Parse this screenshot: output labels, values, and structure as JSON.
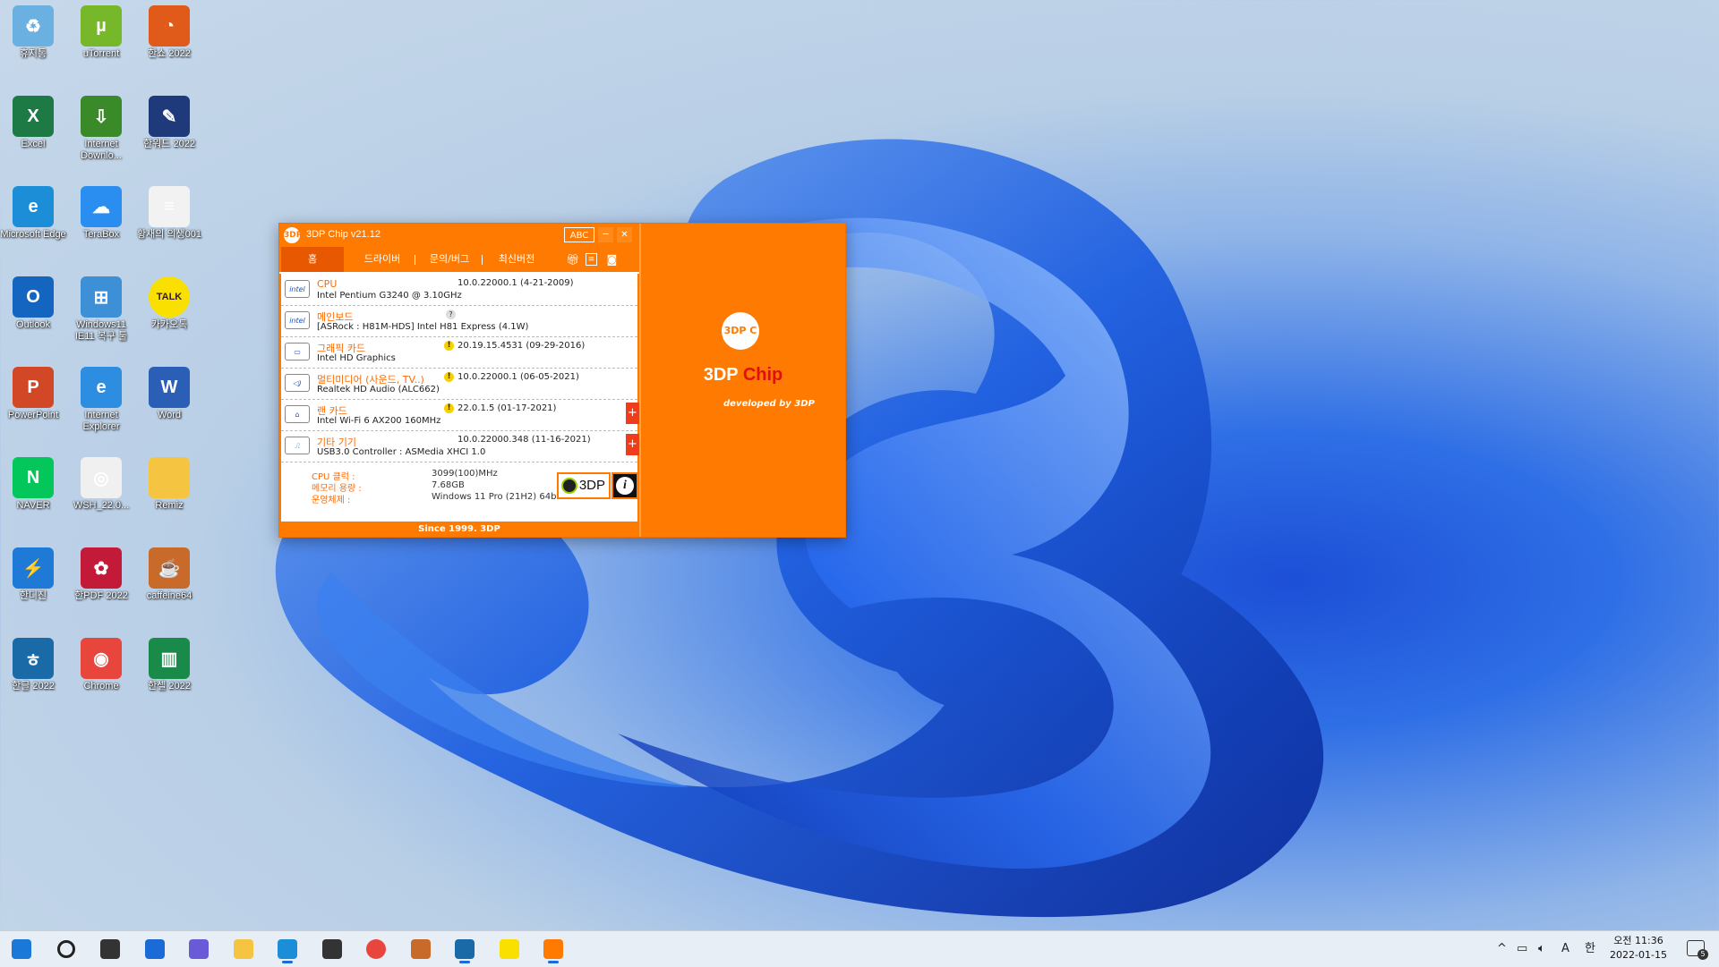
{
  "desktop": {
    "icons": [
      {
        "label": "휴지통",
        "glyph": "♻",
        "color": "#6ab0e0"
      },
      {
        "label": "uTorrent",
        "glyph": "µ",
        "color": "#76b82a"
      },
      {
        "label": "한쇼 2022",
        "glyph": "◔",
        "color": "#e05a1a"
      },
      {
        "label": "Excel",
        "glyph": "X",
        "color": "#1d7a45"
      },
      {
        "label": "Internet Downlo...",
        "glyph": "⇩",
        "color": "#3a8a2a"
      },
      {
        "label": "한워드 2022",
        "glyph": "✎",
        "color": "#1f3a7a"
      },
      {
        "label": "Microsoft Edge",
        "glyph": "e",
        "color": "#1c8ed8"
      },
      {
        "label": "TeraBox",
        "glyph": "☁",
        "color": "#2a8ef0"
      },
      {
        "label": "황새의 의생001",
        "glyph": "≡",
        "color": "#f2f2f2"
      },
      {
        "label": "Outlook",
        "glyph": "O",
        "color": "#1365c0"
      },
      {
        "label": "Windows11 IE11 복구 툴",
        "glyph": "⊞",
        "color": "#3d8fd6"
      },
      {
        "label": "카카오톡",
        "glyph": "TALK",
        "color": "#f9e000"
      },
      {
        "label": "PowerPoint",
        "glyph": "P",
        "color": "#d24726"
      },
      {
        "label": "Internet Explorer",
        "glyph": "e",
        "color": "#2d8de0"
      },
      {
        "label": "Word",
        "glyph": "W",
        "color": "#2b5eb5"
      },
      {
        "label": "NAVER",
        "glyph": "N",
        "color": "#03c75a"
      },
      {
        "label": "WSH_22.0...",
        "glyph": "◎",
        "color": "#f0f0f0"
      },
      {
        "label": "Remiz",
        "glyph": "",
        "color": "#f5c542"
      },
      {
        "label": "한디진",
        "glyph": "⚡",
        "color": "#1e7ad6"
      },
      {
        "label": "한PDF 2022",
        "glyph": "✿",
        "color": "#c41a3a"
      },
      {
        "label": "caffeine64",
        "glyph": "☕",
        "color": "#c86a2a"
      },
      {
        "label": "한글 2022",
        "glyph": "ㅎ",
        "color": "#1a6aa8"
      },
      {
        "label": "Chrome",
        "glyph": "◉",
        "color": "#e8453c"
      },
      {
        "label": "한셀 2022",
        "glyph": "▥",
        "color": "#1a8a4a"
      }
    ]
  },
  "window": {
    "title": "3DP Chip v21.12",
    "logo_text": "3DP",
    "abc_button": "ABC",
    "minimize": "─",
    "close": "✕",
    "nav": [
      "홈",
      "드라이버",
      "문의/버그",
      "최신버전"
    ],
    "nav_icons": [
      "gift-icon",
      "list-icon",
      "camera-icon"
    ],
    "devices": [
      {
        "category": "CPU",
        "name": "Intel Pentium G3240 @ 3.10GHz",
        "version": "10.0.22000.1 (4-21-2009)",
        "icon": "intel",
        "status": "",
        "plus": false
      },
      {
        "category": "메인보드",
        "name": "[ASRock : H81M-HDS] Intel H81 Express (4.1W)",
        "version": "",
        "icon": "intel",
        "status": "?",
        "plus": false
      },
      {
        "category": "그래픽 카드",
        "name": "Intel HD Graphics",
        "version": "20.19.15.4531 (09-29-2016)",
        "icon": "monitor",
        "status": "!",
        "plus": false
      },
      {
        "category": "멀티미디어 (사운드, TV..)",
        "name": "Realtek HD Audio (ALC662)",
        "version": "10.0.22000.1 (06-05-2021)",
        "icon": "speaker",
        "status": "!",
        "plus": false
      },
      {
        "category": "랜 카드",
        "name": "Intel Wi-Fi 6 AX200 160MHz",
        "version": "22.0.1.5 (01-17-2021)",
        "icon": "lan",
        "status": "!",
        "plus": true
      },
      {
        "category": "기타 기기",
        "name": "USB3.0 Controller : ASMedia XHCI 1.0",
        "version": "10.0.22000.348 (11-16-2021)",
        "icon": "usb",
        "status": "",
        "plus": true
      }
    ],
    "plus_label": "+",
    "sysinfo": [
      {
        "label": "CPU 클럭 :",
        "value": "3099(100)MHz"
      },
      {
        "label": "메모리 용량 :",
        "value": "7.68GB"
      },
      {
        "label": "운영체제 :",
        "value": "Windows 11 Pro (21H2) 64bit"
      }
    ],
    "badge_3dp": "3DP",
    "badge_info": "i",
    "footer": "Since 1999. 3DP",
    "side": {
      "circle": "3DP C",
      "brand_white": "3DP ",
      "brand_red": "Chip",
      "developed": "developed by 3DP"
    }
  },
  "taskbar": {
    "apps": [
      {
        "name": "start",
        "color": "#1a78d8",
        "active": false
      },
      {
        "name": "search",
        "color": "#222222",
        "active": false
      },
      {
        "name": "task-view",
        "color": "#333333",
        "active": false
      },
      {
        "name": "widgets",
        "color": "#1a6ad8",
        "active": false
      },
      {
        "name": "chat",
        "color": "#6a5ad8",
        "active": false
      },
      {
        "name": "file-explorer",
        "color": "#f5c542",
        "active": false
      },
      {
        "name": "edge",
        "color": "#1c8ed8",
        "active": true
      },
      {
        "name": "store",
        "color": "#333333",
        "active": false
      },
      {
        "name": "chrome",
        "color": "#e8453c",
        "active": false
      },
      {
        "name": "caffeine",
        "color": "#c86a2a",
        "active": false
      },
      {
        "name": "hangul",
        "color": "#1a6aa8",
        "active": true
      },
      {
        "name": "kakaotalk",
        "color": "#f9e000",
        "active": false
      },
      {
        "name": "3dp-chip",
        "color": "#ff7a00",
        "active": true
      }
    ],
    "tray": {
      "chevron": "^",
      "ime_a": "A",
      "ime_han": "한",
      "time": "오전 11:36",
      "date": "2022-01-15",
      "notifications": "5"
    }
  }
}
